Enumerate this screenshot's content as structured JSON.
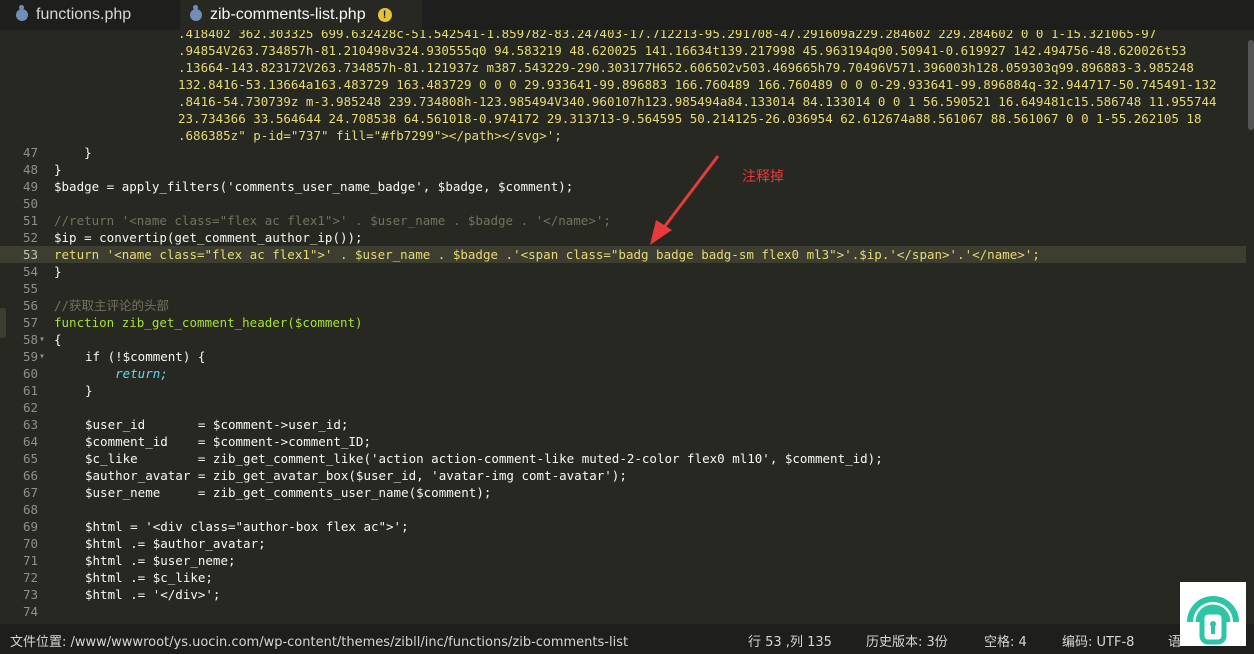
{
  "tabs": [
    {
      "label": "functions.php",
      "active": false
    },
    {
      "label": "zib-comments-list.php",
      "active": true,
      "warning": "!"
    }
  ],
  "wrapped_lines": [
    ".418402 362.303325 699.632428c-51.542541-1.859782-83.247403-17.712213-95.291708-47.291609a229.284602 229.284602 0 0 1-15.321065-97",
    ".94854V263.734857h-81.210498v324.930555q0 94.583219 48.620025 141.16634t139.217998 45.963194q90.50941-0.619927 142.494756-48.620026t53",
    ".13664-143.823172V263.734857h-81.121937z m387.543229-290.303177H652.606502v503.469665h79.70496V571.396003h128.059303q99.896883-3.985248",
    "132.8416-53.13664a163.483729 163.483729 0 0 0 29.933641-99.896883 166.760489 166.760489 0 0 0-29.933641-99.896884q-32.944717-50.745491-132",
    ".8416-54.730739z m-3.985248 239.734808h-123.985494V340.960107h123.985494a84.133014 84.133014 0 0 1 56.590521 16.649481c15.586748 11.955744",
    "23.734366 33.564644 24.708538 64.561018-0.974172 29.313713-9.564595 50.214125-26.036954 62.612674a88.561067 88.561067 0 0 1-55.262105 18",
    ".686385z\" p-id=\"737\" fill=\"#fb7299\"></path></svg>';"
  ],
  "lines": [
    {
      "n": "47",
      "code": "    }"
    },
    {
      "n": "48",
      "code": "}"
    },
    {
      "n": "49",
      "code": "$badge = apply_filters('comments_user_name_badge', $badge, $comment);"
    },
    {
      "n": "50",
      "code": ""
    },
    {
      "n": "51",
      "code": "//return '<name class=\"flex ac flex1\">' . $user_name . $badge . '</name>';"
    },
    {
      "n": "52",
      "code": "$ip = convertip(get_comment_author_ip());"
    },
    {
      "n": "53",
      "code": "return '<name class=\"flex ac flex1\">' . $user_name . $badge .'<span class=\"badg badge badg-sm flex0 ml3\">'.$ip.'</span>'.'</name>';"
    },
    {
      "n": "54",
      "code": "}"
    },
    {
      "n": "55",
      "code": ""
    },
    {
      "n": "56",
      "code": "//获取主评论的头部"
    },
    {
      "n": "57",
      "code": "function zib_get_comment_header($comment)"
    },
    {
      "n": "58",
      "code": "{"
    },
    {
      "n": "59",
      "code": "if (!$comment) {"
    },
    {
      "n": "60",
      "code": "    return;"
    },
    {
      "n": "61",
      "code": "}"
    },
    {
      "n": "62",
      "code": ""
    },
    {
      "n": "63",
      "code": "$user_id       = $comment->user_id;"
    },
    {
      "n": "64",
      "code": "$comment_id    = $comment->comment_ID;"
    },
    {
      "n": "65",
      "code": "$c_like        = zib_get_comment_like('action action-comment-like muted-2-color flex0 ml10', $comment_id);"
    },
    {
      "n": "66",
      "code": "$author_avatar = zib_get_avatar_box($user_id, 'avatar-img comt-avatar');"
    },
    {
      "n": "67",
      "code": "$user_neme     = zib_get_comments_user_name($comment);"
    },
    {
      "n": "68",
      "code": ""
    },
    {
      "n": "69",
      "code": "$html = '<div class=\"author-box flex ac\">';"
    },
    {
      "n": "70",
      "code": "$html .= $author_avatar;"
    },
    {
      "n": "71",
      "code": "$html .= $user_neme;"
    },
    {
      "n": "72",
      "code": "$html .= $c_like;"
    },
    {
      "n": "73",
      "code": "$html .= '</div>';"
    },
    {
      "n": "74",
      "code": ""
    }
  ],
  "annotation": "注释掉",
  "status": {
    "path": "文件位置: /www/wwwroot/ys.uocin.com/wp-content/themes/zibll/inc/functions/zib-comments-list",
    "position": "行 53 ,列 135",
    "history": "历史版本: 3份",
    "spaces": "空格: 4",
    "encoding": "编码: UTF-8",
    "lang": "语"
  },
  "colors": {
    "accent": "#e53b3b",
    "bg": "#272822",
    "string": "#e6db74"
  }
}
